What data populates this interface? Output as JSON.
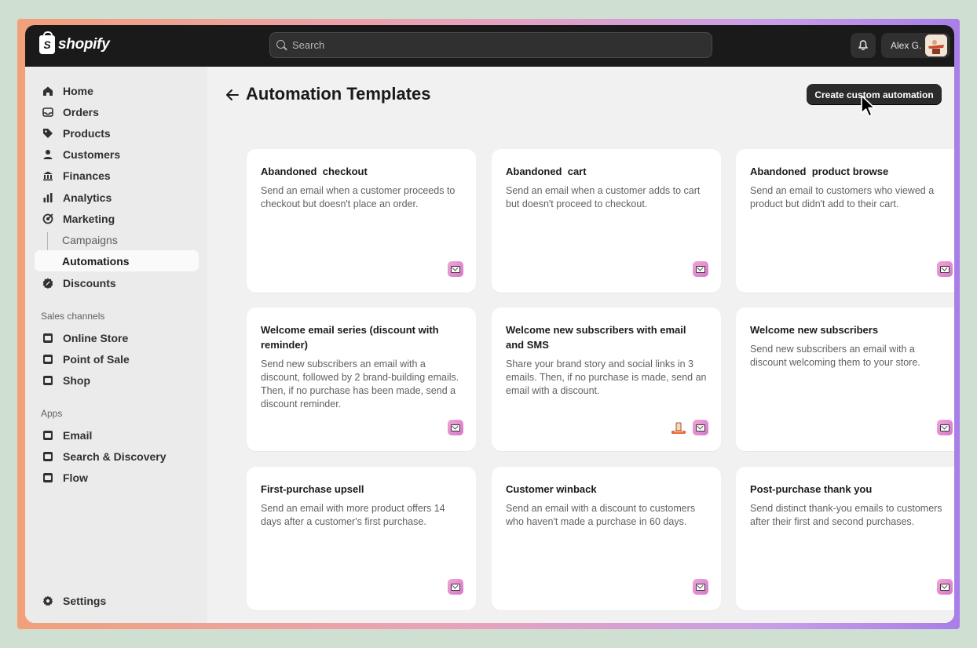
{
  "brand": {
    "logo_text": "shopify"
  },
  "topbar": {
    "search_placeholder": "Search",
    "user_name": "Alex G."
  },
  "sidebar": {
    "main_items": [
      {
        "label": "Home",
        "icon": "home-icon"
      },
      {
        "label": "Orders",
        "icon": "inbox-icon"
      },
      {
        "label": "Products",
        "icon": "tag-icon"
      },
      {
        "label": "Customers",
        "icon": "person-icon"
      },
      {
        "label": "Finances",
        "icon": "bank-icon"
      },
      {
        "label": "Analytics",
        "icon": "bar-chart-icon"
      },
      {
        "label": "Marketing",
        "icon": "target-icon"
      }
    ],
    "marketing_sub": [
      {
        "label": "Campaigns"
      },
      {
        "label": "Automations",
        "active": true
      }
    ],
    "discounts": {
      "label": "Discounts",
      "icon": "discount-icon"
    },
    "sales_channels_label": "Sales channels",
    "sales_channels": [
      {
        "label": "Online Store",
        "icon": "store-icon"
      },
      {
        "label": "Point of Sale",
        "icon": "pos-icon"
      },
      {
        "label": "Shop",
        "icon": "shop-icon"
      }
    ],
    "apps_label": "Apps",
    "apps": [
      {
        "label": "Email",
        "icon": "email-app-icon"
      },
      {
        "label": "Search & Discovery",
        "icon": "search-discovery-icon"
      },
      {
        "label": "Flow",
        "icon": "flow-icon"
      }
    ],
    "settings": {
      "label": "Settings",
      "icon": "gear-icon"
    }
  },
  "main": {
    "title": "Automation Templates",
    "create_button": "Create custom automation",
    "cards": [
      {
        "title": "Abandoned  checkout",
        "desc": "Send an email when a customer proceeds to checkout but doesn't place an order.",
        "sms": false
      },
      {
        "title": "Abandoned  cart",
        "desc": "Send an email when a customer adds to cart but doesn't proceed to checkout.",
        "sms": false
      },
      {
        "title": "Abandoned  product browse",
        "desc": "Send an email to customers who viewed a product but didn't add to their cart.",
        "sms": false
      },
      {
        "title": "Welcome email series (discount with reminder)",
        "desc": "Send new subscribers an email with a discount, followed by 2 brand-building emails. Then, if no purchase has been made, send a discount reminder.",
        "sms": false
      },
      {
        "title": "Welcome new subscribers with email and SMS",
        "desc": "Share your brand story and social links in 3 emails. Then, if no purchase is made, send an email with a discount.",
        "sms": true
      },
      {
        "title": "Welcome new subscribers",
        "desc": "Send new subscribers an email with a discount welcoming them to your store.",
        "sms": false
      },
      {
        "title": "First-purchase upsell",
        "desc": "Send an email with more product offers 14 days after a customer's first purchase.",
        "sms": false
      },
      {
        "title": "Customer winback",
        "desc": "Send an email with a discount to customers who haven't made a purchase in 60 days.",
        "sms": false
      },
      {
        "title": "Post-purchase thank you",
        "desc": "Send distinct thank-you emails to customers after their first and second purchases.",
        "sms": false
      }
    ]
  }
}
